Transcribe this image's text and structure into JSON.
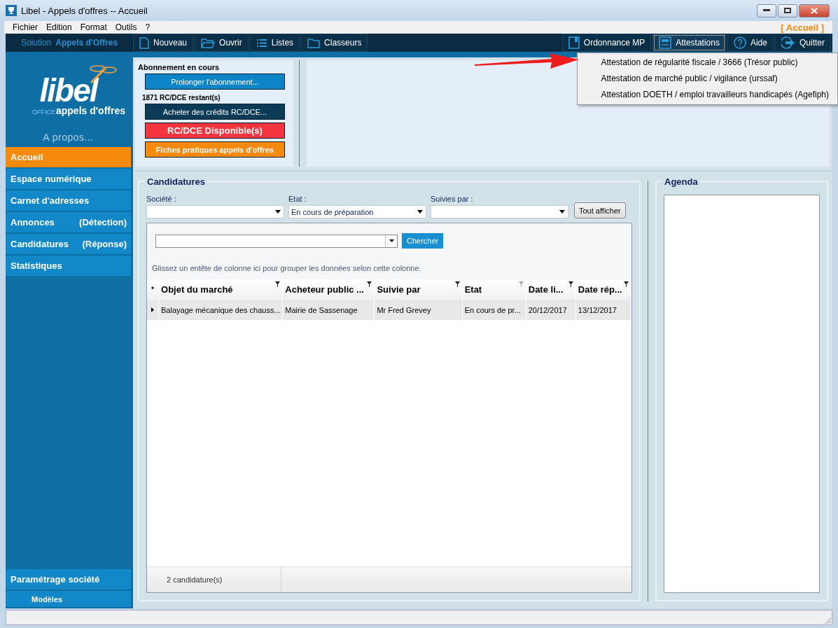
{
  "window": {
    "title": "Libel - Appels d'offres -- Accueil"
  },
  "menu": [
    "Fichier",
    "Edition",
    "Format",
    "Outils",
    "?"
  ],
  "breadcrumb": "[ Accueil ]",
  "toolbar": {
    "solution_label": "Solution",
    "solution_name": "Appels d'Offres",
    "left": [
      {
        "label": "Nouveau",
        "kind": "document",
        "selected": false
      },
      {
        "label": "Ouvrir",
        "kind": "folder-open",
        "selected": false
      },
      {
        "label": "Listes",
        "kind": "list",
        "selected": false
      },
      {
        "label": "Classeurs",
        "kind": "folder",
        "selected": false
      }
    ],
    "right": [
      {
        "label": "Ordonnance MP",
        "kind": "book",
        "selected": false
      },
      {
        "label": "Attestations",
        "kind": "form",
        "selected": true
      },
      {
        "label": "Aide",
        "kind": "help",
        "selected": false
      },
      {
        "label": "Quitter",
        "kind": "exit",
        "selected": false
      }
    ]
  },
  "attestations_menu": [
    "Attestation de régularité fiscale / 3666 (Trésor public)",
    "Attestation de marché public / vigilance (urssaf)",
    "Attestation DOETH / emploi travailleurs handicapés (Agefiph)"
  ],
  "sidebar": {
    "logo": {
      "wordmark": "libel",
      "prefix": "OFFICE",
      "tagline": "appels d'offres"
    },
    "about": "A propos...",
    "items": [
      {
        "label": "Accueil",
        "selected": true
      },
      {
        "label": "Espace numérique",
        "selected": false
      },
      {
        "label": "Carnet d'adresses",
        "selected": false
      },
      {
        "label": "Annonces",
        "detail": "(Détection)",
        "selected": false
      },
      {
        "label": "Candidatures",
        "detail": "(Réponse)",
        "selected": false
      },
      {
        "label": "Statistiques",
        "selected": false
      }
    ],
    "bottom_items": [
      {
        "label": "Paramétrage société",
        "kind": "main"
      },
      {
        "label": "Modèles",
        "kind": "sub"
      }
    ]
  },
  "subscription": {
    "title": "Abonnement en cours",
    "items": [
      {
        "kind": "button",
        "label": "Prolonger l'abonnement...",
        "color": "#0b84c8"
      },
      {
        "kind": "note",
        "label": "1871 RC/DCE restant(s)"
      },
      {
        "kind": "button",
        "label": "Acheter des crédits RC/DCE...",
        "color": "#0c3b58"
      },
      {
        "kind": "button",
        "label": "RC/DCE Disponible(s)",
        "color": "#f5353d"
      },
      {
        "kind": "button",
        "label": "Fiches pratiques appels d'offres",
        "color": "#f68a0c"
      }
    ]
  },
  "candidatures": {
    "title": "Candidatures",
    "filters": [
      {
        "label": "Société :"
      },
      {
        "label": "Etat :",
        "value": "En cours de préparation"
      },
      {
        "label": "Suivies par :"
      }
    ],
    "show_all": "Tout afficher",
    "search_button": "Chercher",
    "group_hint": "Glissez un entête de colonne ici pour grouper les données selon cette colonne.",
    "new_row_marker": "*",
    "columns": [
      "Objet du marché",
      "Acheteur public ...",
      "Suivie par",
      "Etat",
      "Date li...",
      "Date rép..."
    ],
    "rows": [
      {
        "selected": true,
        "cells": [
          "Balayage mécanique des chauss...",
          "Mairie de Sassenage",
          "Mr Fred Grevey",
          "En cours de pr...",
          "20/12/2017",
          "13/12/2017"
        ]
      }
    ],
    "footer": "2 candidature(s)"
  },
  "agenda": {
    "title": "Agenda"
  }
}
